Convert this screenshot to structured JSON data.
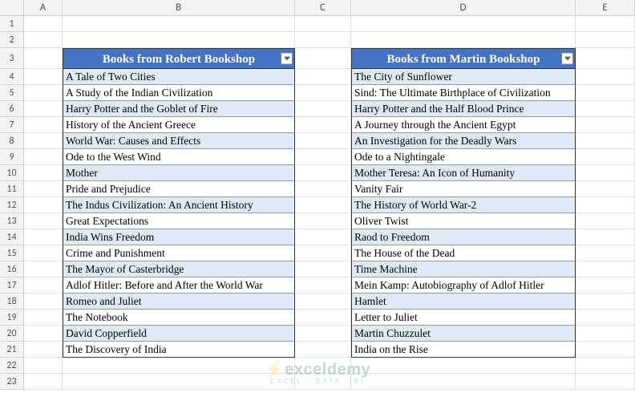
{
  "columns": [
    "A",
    "B",
    "C",
    "D",
    "E"
  ],
  "rowStart": 1,
  "rowEnd": 23,
  "tables": {
    "left": {
      "header": "Books from Robert Bookshop",
      "rows": [
        "A Tale of Two Cities",
        "A Study of the Indian Civilization",
        "Harry Potter and the Goblet of Fire",
        "History of the Ancient Greece",
        "World War: Causes and Effects",
        "Ode to the West Wind",
        "Mother",
        "Pride and Prejudice",
        "The Indus Civilization: An Ancient History",
        "Great Expectations",
        "India Wins Freedom",
        "Crime and Punishment",
        "The Mayor of Casterbridge",
        "Adlof Hitler: Before and After the World War",
        "Romeo and Juliet",
        "The Notebook",
        "David Copperfield",
        "The Discovery of India"
      ]
    },
    "right": {
      "header": "Books from Martin Bookshop",
      "rows": [
        "The City of Sunflower",
        "Sind: The Ultimate Birthplace of Civilization",
        "Harry Potter and the Half Blood Prince",
        "A Journey through the Ancient Egypt",
        "An Investigation for the Deadly Wars",
        "Ode to a Nightingale",
        "Mother Teresa: An Icon of Humanity",
        "Vanity Fair",
        "The History of World War-2",
        "Oliver Twist",
        "Raod to Freedom",
        "The House of the Dead",
        "Time Machine",
        "Mein Kamp: Autobiography of Adlof Hitler",
        "Hamlet",
        "Letter to Juliet",
        "Martin Chuzzulet",
        "India on the Rise"
      ]
    }
  },
  "watermark": {
    "brand": "exceldemy",
    "tag": "EXCEL · DATA · BI"
  }
}
